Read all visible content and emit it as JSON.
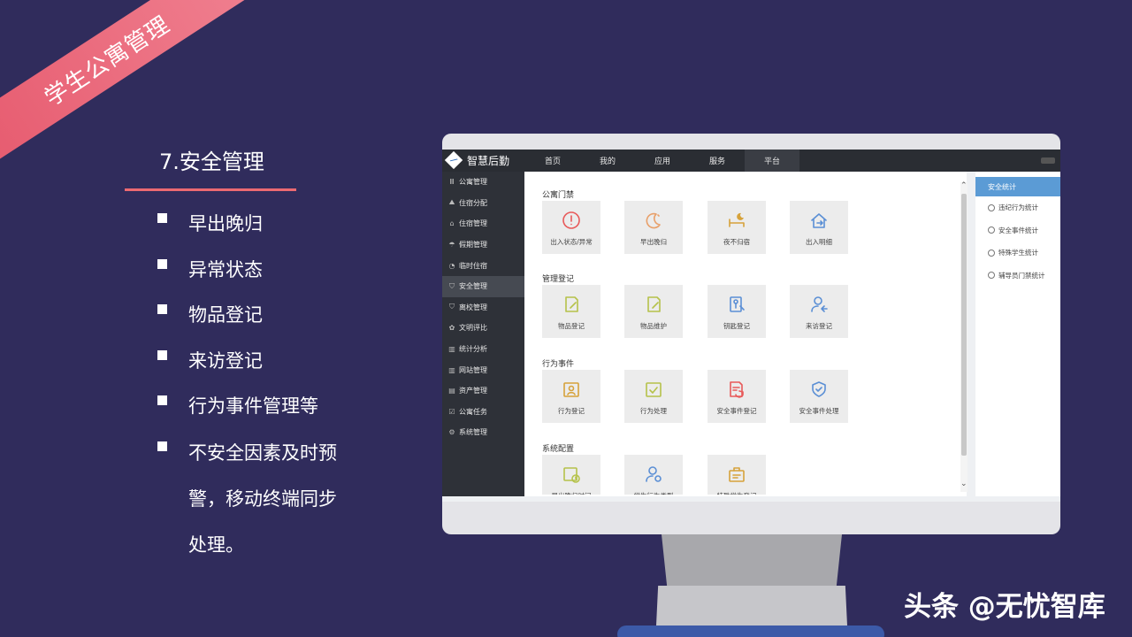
{
  "ribbon": {
    "text": "学生公寓管理"
  },
  "section": {
    "title": "7.安全管理",
    "bullets": [
      "早出晚归",
      "异常状态",
      "物品登记",
      "来访登记",
      "行为事件管理等",
      "不安全因素及时预警，移动终端同步处理。"
    ]
  },
  "app": {
    "logo_text": "智慧后勤",
    "nav": [
      "首页",
      "我的",
      "应用",
      "服务",
      "平台"
    ],
    "nav_active_index": 4,
    "sidebar": [
      {
        "icon": "bars-icon",
        "label": "公寓管理"
      },
      {
        "icon": "bed-icon",
        "label": "住宿分配"
      },
      {
        "icon": "building-icon",
        "label": "住宿管理"
      },
      {
        "icon": "holiday-icon",
        "label": "假期管理"
      },
      {
        "icon": "clock-icon",
        "label": "临时住宿"
      },
      {
        "icon": "shield-icon",
        "label": "安全管理"
      },
      {
        "icon": "shield-icon",
        "label": "离校管理"
      },
      {
        "icon": "award-icon",
        "label": "文明评比"
      },
      {
        "icon": "chart-icon",
        "label": "统计分析"
      },
      {
        "icon": "chart-icon",
        "label": "网站管理"
      },
      {
        "icon": "asset-icon",
        "label": "资产管理"
      },
      {
        "icon": "task-icon",
        "label": "公寓任务"
      },
      {
        "icon": "gear-icon",
        "label": "系统管理"
      }
    ],
    "sidebar_active_index": 5,
    "groups": [
      {
        "title": "公寓门禁",
        "tiles": [
          {
            "label": "出入状态/异常",
            "icon": "alert-icon",
            "color": "#e85a5a"
          },
          {
            "label": "早出晚归",
            "icon": "moon-icon",
            "color": "#e8a06a"
          },
          {
            "label": "夜不归宿",
            "icon": "bed-moon-icon",
            "color": "#d6a23a"
          },
          {
            "label": "出入明细",
            "icon": "home-arrow-icon",
            "color": "#5b8fd5"
          }
        ]
      },
      {
        "title": "管理登记",
        "tiles": [
          {
            "label": "物品登记",
            "icon": "note-edit-icon",
            "color": "#b5c24a"
          },
          {
            "label": "物品维护",
            "icon": "note-edit-icon",
            "color": "#b5c24a"
          },
          {
            "label": "钥匙登记",
            "icon": "key-doc-icon",
            "color": "#5b8fd5"
          },
          {
            "label": "来访登记",
            "icon": "visitor-icon",
            "color": "#5b8fd5"
          }
        ]
      },
      {
        "title": "行为事件",
        "tiles": [
          {
            "label": "行为登记",
            "icon": "person-calendar-icon",
            "color": "#d6a23a"
          },
          {
            "label": "行为处理",
            "icon": "check-calendar-icon",
            "color": "#b5c24a"
          },
          {
            "label": "安全事件登记",
            "icon": "doc-shield-icon",
            "color": "#e85a5a"
          },
          {
            "label": "安全事件处理",
            "icon": "shield-check-icon",
            "color": "#5b8fd5"
          }
        ]
      },
      {
        "title": "系统配置",
        "tiles": [
          {
            "label": "早出晚归时间",
            "icon": "calendar-clock-icon",
            "color": "#b5c24a"
          },
          {
            "label": "学生行为类型",
            "icon": "user-gear-icon",
            "color": "#5b8fd5"
          },
          {
            "label": "特殊学生登记",
            "icon": "briefcase-icon",
            "color": "#d6a23a"
          }
        ]
      }
    ],
    "right_panel": {
      "header": "安全统计",
      "items": [
        "违纪行为统计",
        "安全事件统计",
        "特殊学生统计",
        "辅导员门禁统计"
      ]
    }
  },
  "watermark": "头条 @无忧智库"
}
